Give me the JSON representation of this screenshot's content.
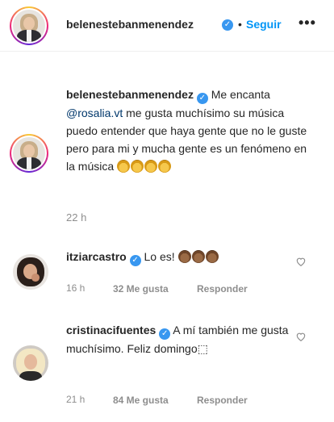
{
  "header": {
    "username": "belenestebanmenendez",
    "separator": "•",
    "follow_label": "Seguir",
    "more_label": "•••"
  },
  "caption": {
    "username": "belenestebanmenendez",
    "text_before": "Me encanta ",
    "mention": "@rosalia.vt",
    "text_after": " me gusta muchísimo su música puedo entender que haya gente que no le guste pero para mi y mucha gente es un fenómeno en la música ",
    "clap_count": 4,
    "time": "22 h"
  },
  "comments": [
    {
      "username": "itziarcastro",
      "text": "Lo es! ",
      "clap_count": 3,
      "time": "16 h",
      "likes": "32 Me gusta",
      "reply_label": "Responder"
    },
    {
      "username": "cristinacifuentes",
      "text": "A mí también me gusta muchísimo. Feliz domingo⬚",
      "time": "21 h",
      "likes": "84 Me gusta",
      "reply_label": "Responder"
    }
  ],
  "colors": {
    "verified": "#3897f0",
    "follow": "#0095f6",
    "mention": "#00376b",
    "meta": "#8e8e8e"
  },
  "icons": {
    "verified": "verified-badge-icon",
    "clap": "clapping-hands-emoji",
    "heart": "heart-outline-icon"
  }
}
